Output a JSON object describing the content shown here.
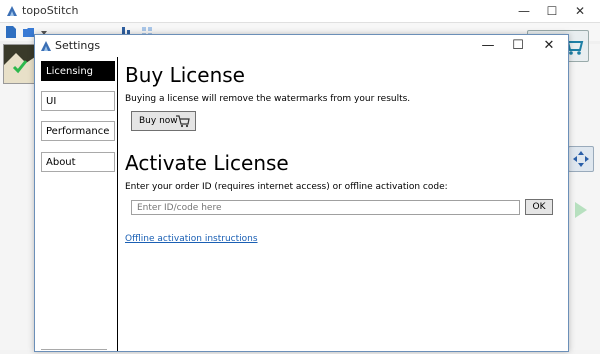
{
  "main_window": {
    "title": "topoStitch",
    "controls": {
      "minimize": "—",
      "maximize": "☐",
      "close": "✕"
    }
  },
  "dialog": {
    "title": "Settings",
    "controls": {
      "minimize": "—",
      "maximize": "☐",
      "close": "✕"
    },
    "sidebar": {
      "items": [
        {
          "label": "Licensing",
          "active": true
        },
        {
          "label": "UI",
          "active": false
        },
        {
          "label": "Performance",
          "active": false
        },
        {
          "label": "About",
          "active": false
        }
      ]
    },
    "buy": {
      "heading": "Buy License",
      "description": "Buying a license will remove the watermarks from your results.",
      "button_label": "Buy now"
    },
    "activate": {
      "heading": "Activate License",
      "description": "Enter your order ID (requires internet access) or offline activation code:",
      "input_value": "",
      "input_placeholder": "Enter ID/code here",
      "ok_label": "OK",
      "offline_link": "Offline activation instructions"
    }
  },
  "colors": {
    "link": "#1a5fb4",
    "active_tab_bg": "#000000",
    "dialog_border": "#6b8fb8"
  }
}
